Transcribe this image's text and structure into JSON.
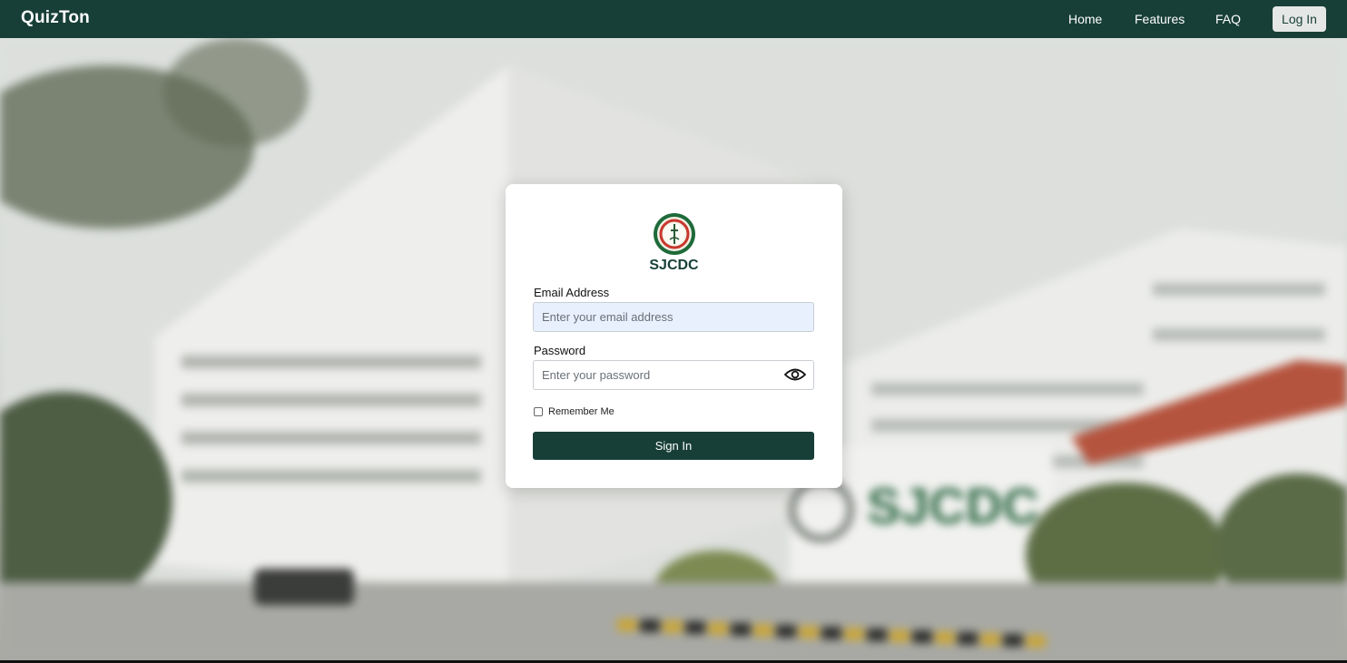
{
  "navbar": {
    "brand": "QuizTon",
    "links": [
      "Home",
      "Features",
      "FAQ"
    ],
    "login_label": "Log In"
  },
  "background": {
    "sign_text": "SJCDC"
  },
  "login_card": {
    "org_name": "SJCDC",
    "email_label": "Email Address",
    "email_placeholder": "Enter your email address",
    "password_label": "Password",
    "password_placeholder": "Enter your password",
    "remember_label": "Remember Me",
    "remember_checked": false,
    "submit_label": "Sign In"
  },
  "colors": {
    "primary": "#173f37",
    "email_input_bg": "#e8f0fe",
    "card_bg": "#ffffff"
  },
  "icons": {
    "password_toggle": "eye-icon",
    "logo": "sjcdc-seal-logo"
  }
}
